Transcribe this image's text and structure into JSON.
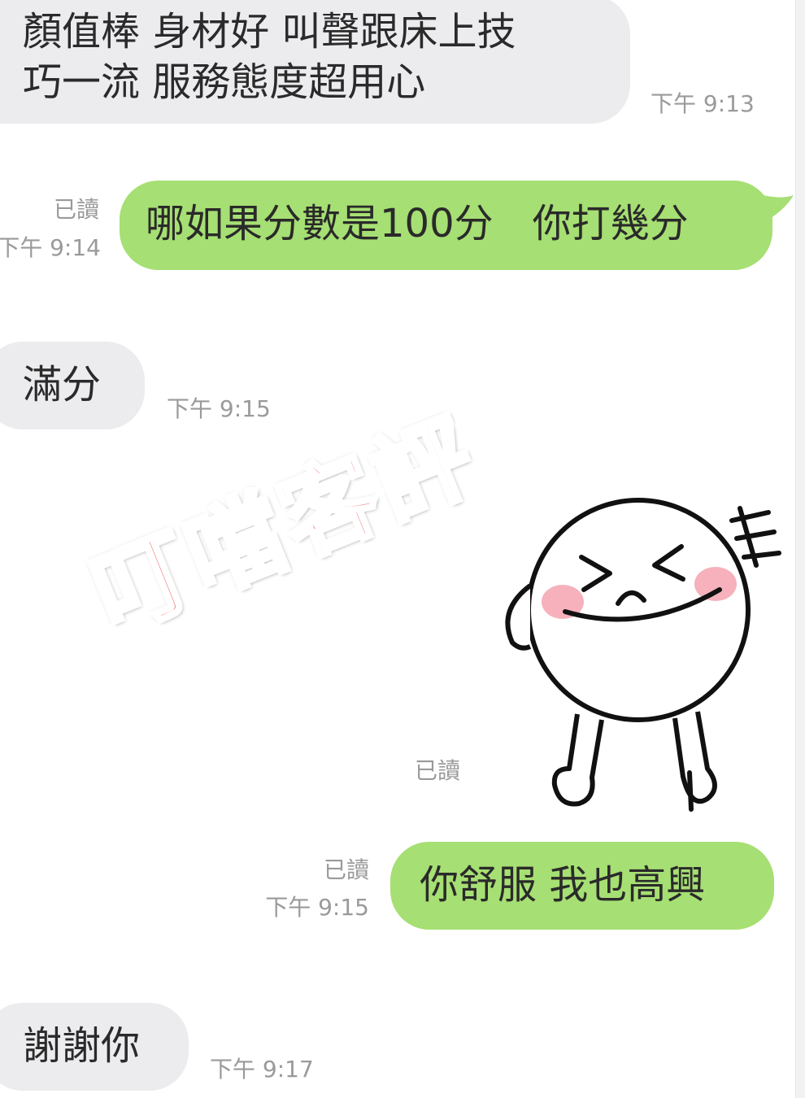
{
  "messages": [
    {
      "direction": "incoming",
      "lines": [
        "顏值棒 身材好 叫聲跟床上技",
        "巧一流 服務態度超用心"
      ],
      "time": "下午 9:13"
    },
    {
      "direction": "outgoing",
      "text": "哪如果分數是100分　你打幾分",
      "read": "已讀",
      "time": "下午 9:14"
    },
    {
      "direction": "incoming",
      "text": "滿分",
      "time": "下午 9:15"
    },
    {
      "direction": "outgoing",
      "sticker": "laughing-face-sticker",
      "read": "已讀"
    },
    {
      "direction": "outgoing",
      "text": "你舒服 我也高興",
      "read": "已讀",
      "time": "下午 9:15"
    },
    {
      "direction": "incoming",
      "text": "謝謝你",
      "time": "下午 9:17"
    }
  ],
  "watermark": "叮噹客評",
  "colors": {
    "incoming_bubble": "#ececef",
    "outgoing_bubble": "#a6df73",
    "meta_text": "#9a9a9a",
    "watermark": "#ef4a5a"
  }
}
